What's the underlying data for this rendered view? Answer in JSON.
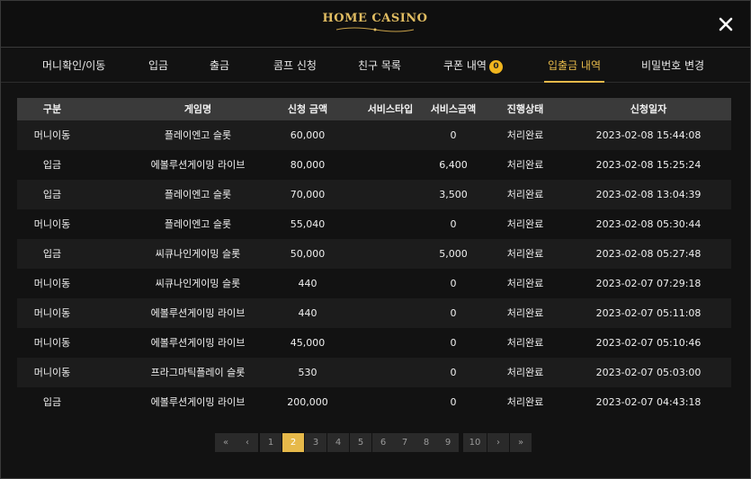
{
  "header": {
    "logo_text": "HOME CASINO",
    "close_icon": "close-icon"
  },
  "tabs": [
    {
      "label": "머니확인/이동",
      "active": false
    },
    {
      "label": "입금",
      "active": false
    },
    {
      "label": "출금",
      "active": false
    },
    {
      "label": "콤프 신청",
      "active": false
    },
    {
      "label": "친구 목록",
      "active": false
    },
    {
      "label": "쿠폰 내역",
      "badge": "0",
      "active": false
    },
    {
      "label": "입출금 내역",
      "active": true
    },
    {
      "label": "비밀번호 변경",
      "active": false
    }
  ],
  "table": {
    "columns": [
      "구분",
      "게임명",
      "신청 금액",
      "서비스타입",
      "서비스금액",
      "진행상태",
      "신청일자"
    ],
    "rows": [
      [
        "머니이동",
        "플레이엔고 슬롯",
        "60,000",
        "",
        "0",
        "처리완료",
        "2023-02-08 15:44:08"
      ],
      [
        "입금",
        "에볼루션게이밍 라이브",
        "80,000",
        "",
        "6,400",
        "처리완료",
        "2023-02-08 15:25:24"
      ],
      [
        "입금",
        "플레이엔고 슬롯",
        "70,000",
        "",
        "3,500",
        "처리완료",
        "2023-02-08 13:04:39"
      ],
      [
        "머니이동",
        "플레이엔고 슬롯",
        "55,040",
        "",
        "0",
        "처리완료",
        "2023-02-08 05:30:44"
      ],
      [
        "입금",
        "씨큐나인게이밍 슬롯",
        "50,000",
        "",
        "5,000",
        "처리완료",
        "2023-02-08 05:27:48"
      ],
      [
        "머니이동",
        "씨큐나인게이밍 슬롯",
        "440",
        "",
        "0",
        "처리완료",
        "2023-02-07 07:29:18"
      ],
      [
        "머니이동",
        "에볼루션게이밍 라이브",
        "440",
        "",
        "0",
        "처리완료",
        "2023-02-07 05:11:08"
      ],
      [
        "머니이동",
        "에볼루션게이밍 라이브",
        "45,000",
        "",
        "0",
        "처리완료",
        "2023-02-07 05:10:46"
      ],
      [
        "머니이동",
        "프라그마틱플레이 슬롯",
        "530",
        "",
        "0",
        "처리완료",
        "2023-02-07 05:03:00"
      ],
      [
        "입금",
        "에볼루션게이밍 라이브",
        "200,000",
        "",
        "0",
        "처리완료",
        "2023-02-07 04:43:18"
      ]
    ]
  },
  "pagination": {
    "first": "«",
    "prev": "‹",
    "pages": [
      "1",
      "2",
      "3",
      "4",
      "5",
      "6",
      "7",
      "8",
      "9",
      "10"
    ],
    "current": "2",
    "next": "›",
    "last": "»"
  },
  "colors": {
    "accent": "#e6b94a",
    "badge": "#f0b51e",
    "header_row": "#3a3a3a"
  }
}
